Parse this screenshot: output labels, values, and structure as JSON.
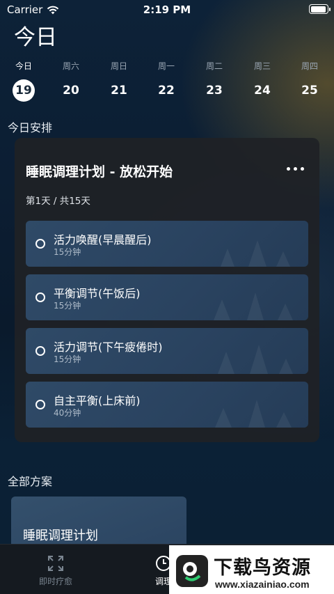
{
  "status_bar": {
    "carrier": "Carrier",
    "time": "2:19 PM"
  },
  "page_title": "今日",
  "week": [
    {
      "name": "今日",
      "num": "19",
      "selected": true
    },
    {
      "name": "周六",
      "num": "20"
    },
    {
      "name": "周日",
      "num": "21"
    },
    {
      "name": "周一",
      "num": "22"
    },
    {
      "name": "周二",
      "num": "23"
    },
    {
      "name": "周三",
      "num": "24"
    },
    {
      "name": "周四",
      "num": "25"
    }
  ],
  "today_section_title": "今日安排",
  "plan": {
    "title": "睡眠调理计划 - 放松开始",
    "progress": "第1天 / 共15天",
    "tasks": [
      {
        "name": "活力唤醒(早晨醒后)",
        "duration": "15分钟"
      },
      {
        "name": "平衡调节(午饭后)",
        "duration": "15分钟"
      },
      {
        "name": "活力调节(下午疲倦时)",
        "duration": "15分钟"
      },
      {
        "name": "自主平衡(上床前)",
        "duration": "40分钟"
      }
    ]
  },
  "all_section_title": "全部方案",
  "program_card": {
    "name": "睡眠调理计划"
  },
  "tabs": [
    {
      "label": "即时疗愈",
      "icon": "expand-arrows-icon",
      "active": false
    },
    {
      "label": "调理",
      "icon": "clock-icon",
      "active": true
    }
  ],
  "watermark": {
    "title": "下载鸟资源",
    "url": "www.xiazainiao.com"
  }
}
